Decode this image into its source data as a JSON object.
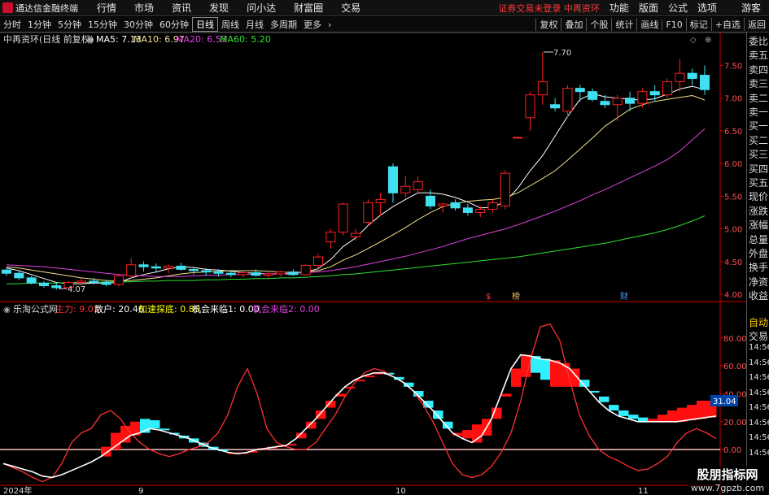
{
  "app": {
    "title": "通达信金融终端"
  },
  "menu": [
    "行情",
    "市场",
    "资讯",
    "发现",
    "问小达",
    "财富圈",
    "交易"
  ],
  "login_status": "证券交易未登录  中再资环",
  "top_right": [
    "功能",
    "版面",
    "公式",
    "选项"
  ],
  "guest": "游客",
  "periods": [
    "分时",
    "1分钟",
    "5分钟",
    "15分钟",
    "30分钟",
    "60分钟",
    "日线",
    "周线",
    "月线",
    "多周期",
    "更多"
  ],
  "active_period": "日线",
  "toolbar_right": [
    "复权",
    "叠加",
    "个股",
    "统计",
    "画线",
    "F10",
    "标记",
    "+自选",
    "返回"
  ],
  "stock": {
    "title": "中再资环(日线 前复权)"
  },
  "ma": [
    {
      "label": "MA5: 7.13",
      "color": "#ffffff"
    },
    {
      "label": "MA10: 6.97",
      "color": "#f2e28a"
    },
    {
      "label": "MA20: 6.53",
      "color": "#e040e0"
    },
    {
      "label": "MA60: 5.20",
      "color": "#30e030"
    }
  ],
  "price_annotations": {
    "high": "7.70",
    "low": "4.07"
  },
  "event_marks": [
    {
      "label": "$",
      "color": "#ff4040"
    },
    {
      "label": "榜",
      "color": "#f0c060"
    },
    {
      "label": "财",
      "color": "#4aa0ff"
    }
  ],
  "indicator": {
    "name": "乐淘公式网",
    "values": [
      {
        "label": "主力: 9.03",
        "color": "#ff3030"
      },
      {
        "label": "散户: 20.46",
        "color": "#ffffff"
      },
      {
        "label": "加速探底: 0.85",
        "color": "#ffff00"
      },
      {
        "label": "机会来临1: 0.00",
        "color": "#ffffff"
      },
      {
        "label": "机会来临2: 0.00",
        "color": "#e040e0"
      }
    ],
    "current_value": "31.04"
  },
  "date_labels": [
    "2024年",
    "9",
    "10",
    "11"
  ],
  "right_panel": [
    "委比",
    "卖五",
    "卖四",
    "卖三",
    "卖二",
    "卖一",
    "买一",
    "买二",
    "买三",
    "买四",
    "买五",
    "现价",
    "涨跌",
    "涨幅",
    "总量",
    "外盘",
    "换手",
    "净资",
    "收益",
    "自动",
    "交易"
  ],
  "right_panel_times": [
    "14:56",
    "14:56",
    "14:56",
    "14:56",
    "14:56",
    "14:56",
    "14:56",
    "14:56"
  ],
  "watermark": {
    "line1": "股朋指标网",
    "line2": "www.7gpzb.com"
  },
  "chart_data": [
    {
      "type": "candlestick",
      "title": "中再资环(日线 前复权)",
      "y_ticks": [
        4.0,
        4.5,
        5.0,
        5.5,
        6.0,
        6.5,
        7.0,
        7.5
      ],
      "ylim": [
        3.9,
        7.78
      ],
      "grid": false,
      "up_color": "#ff2020",
      "down_color": "#40e0f0",
      "candles": [
        [
          4.37,
          4.4,
          4.28,
          4.32
        ],
        [
          4.32,
          4.36,
          4.22,
          4.25
        ],
        [
          4.25,
          4.28,
          4.15,
          4.17
        ],
        [
          4.17,
          4.2,
          4.1,
          4.13
        ],
        [
          4.13,
          4.18,
          4.07,
          4.1
        ],
        [
          4.1,
          4.2,
          4.08,
          4.18
        ],
        [
          4.18,
          4.24,
          4.14,
          4.2
        ],
        [
          4.2,
          4.25,
          4.15,
          4.18
        ],
        [
          4.18,
          4.22,
          4.12,
          4.15
        ],
        [
          4.15,
          4.3,
          4.12,
          4.28
        ],
        [
          4.28,
          4.55,
          4.25,
          4.45
        ],
        [
          4.45,
          4.5,
          4.35,
          4.42
        ],
        [
          4.42,
          4.47,
          4.33,
          4.4
        ],
        [
          4.4,
          4.45,
          4.32,
          4.43
        ],
        [
          4.43,
          4.48,
          4.36,
          4.38
        ],
        [
          4.38,
          4.42,
          4.3,
          4.36
        ],
        [
          4.36,
          4.4,
          4.28,
          4.34
        ],
        [
          4.34,
          4.38,
          4.27,
          4.32
        ],
        [
          4.32,
          4.36,
          4.26,
          4.3
        ],
        [
          4.3,
          4.35,
          4.26,
          4.33
        ],
        [
          4.33,
          4.38,
          4.27,
          4.29
        ],
        [
          4.29,
          4.34,
          4.24,
          4.31
        ],
        [
          4.31,
          4.36,
          4.27,
          4.34
        ],
        [
          4.34,
          4.38,
          4.28,
          4.3
        ],
        [
          4.3,
          4.46,
          4.29,
          4.44
        ],
        [
          4.44,
          4.62,
          4.4,
          4.57
        ],
        [
          4.8,
          5.0,
          4.7,
          4.95
        ],
        [
          4.95,
          5.4,
          4.9,
          5.38
        ],
        [
          4.88,
          5.0,
          4.82,
          4.93
        ],
        [
          5.1,
          5.45,
          5.05,
          5.4
        ],
        [
          5.4,
          5.55,
          5.2,
          5.45
        ],
        [
          5.95,
          6.0,
          5.4,
          5.55
        ],
        [
          5.55,
          5.8,
          5.48,
          5.65
        ],
        [
          5.6,
          5.8,
          5.55,
          5.72
        ],
        [
          5.5,
          5.6,
          5.3,
          5.35
        ],
        [
          5.35,
          5.4,
          5.25,
          5.38
        ],
        [
          5.4,
          5.45,
          5.28,
          5.32
        ],
        [
          5.32,
          5.38,
          5.2,
          5.25
        ],
        [
          5.25,
          5.35,
          5.18,
          5.3
        ],
        [
          5.3,
          5.45,
          5.25,
          5.4
        ],
        [
          5.35,
          5.9,
          5.3,
          5.85
        ],
        [
          6.4,
          6.4,
          6.4,
          6.4
        ],
        [
          6.7,
          7.1,
          6.5,
          7.05
        ],
        [
          7.05,
          7.7,
          6.9,
          7.25
        ],
        [
          6.9,
          7.0,
          6.8,
          6.85
        ],
        [
          6.8,
          7.2,
          6.7,
          7.15
        ],
        [
          7.15,
          7.2,
          6.95,
          7.1
        ],
        [
          7.1,
          7.15,
          6.95,
          6.98
        ],
        [
          6.95,
          7.05,
          6.85,
          6.9
        ],
        [
          6.9,
          7.05,
          6.65,
          7.0
        ],
        [
          7.0,
          7.1,
          6.8,
          6.92
        ],
        [
          6.92,
          7.15,
          6.85,
          7.1
        ],
        [
          7.1,
          7.2,
          6.95,
          7.05
        ],
        [
          7.05,
          7.3,
          7.0,
          7.25
        ],
        [
          7.25,
          7.6,
          7.1,
          7.38
        ],
        [
          7.38,
          7.45,
          7.2,
          7.3
        ],
        [
          7.35,
          7.5,
          7.05,
          7.13
        ]
      ],
      "ma_series": [
        {
          "name": "MA5",
          "color": "#ffffff",
          "values": [
            4.4,
            4.36,
            4.3,
            4.24,
            4.18,
            4.16,
            4.16,
            4.17,
            4.17,
            4.18,
            4.25,
            4.3,
            4.34,
            4.39,
            4.42,
            4.41,
            4.38,
            4.37,
            4.35,
            4.33,
            4.32,
            4.31,
            4.31,
            4.31,
            4.34,
            4.39,
            4.53,
            4.73,
            4.86,
            5.05,
            5.21,
            5.34,
            5.45,
            5.55,
            5.55,
            5.53,
            5.48,
            5.41,
            5.32,
            5.33,
            5.42,
            5.62,
            5.89,
            6.12,
            6.42,
            6.72,
            6.98,
            7.07,
            7.02,
            7.0,
            6.98,
            6.97,
            6.99,
            7.06,
            7.14,
            7.18,
            7.13
          ]
        },
        {
          "name": "MA10",
          "color": "#f2e28a",
          "values": [
            4.42,
            4.4,
            4.37,
            4.34,
            4.31,
            4.28,
            4.25,
            4.23,
            4.21,
            4.2,
            4.21,
            4.23,
            4.25,
            4.28,
            4.31,
            4.33,
            4.34,
            4.35,
            4.36,
            4.36,
            4.36,
            4.35,
            4.34,
            4.33,
            4.34,
            4.36,
            4.42,
            4.52,
            4.6,
            4.7,
            4.8,
            4.91,
            5.02,
            5.14,
            5.25,
            5.34,
            5.39,
            5.42,
            5.44,
            5.45,
            5.48,
            5.55,
            5.66,
            5.77,
            5.89,
            6.05,
            6.22,
            6.39,
            6.57,
            6.7,
            6.83,
            6.9,
            6.95,
            6.98,
            7.01,
            7.04,
            6.97
          ]
        },
        {
          "name": "MA20",
          "color": "#e040e0",
          "values": [
            4.45,
            4.44,
            4.43,
            4.42,
            4.4,
            4.38,
            4.36,
            4.34,
            4.32,
            4.3,
            4.29,
            4.28,
            4.27,
            4.27,
            4.27,
            4.28,
            4.29,
            4.29,
            4.3,
            4.3,
            4.31,
            4.31,
            4.32,
            4.32,
            4.33,
            4.34,
            4.36,
            4.39,
            4.42,
            4.46,
            4.5,
            4.54,
            4.58,
            4.63,
            4.68,
            4.73,
            4.79,
            4.85,
            4.9,
            4.95,
            5.0,
            5.06,
            5.13,
            5.2,
            5.27,
            5.35,
            5.43,
            5.52,
            5.6,
            5.69,
            5.78,
            5.87,
            5.96,
            6.06,
            6.19,
            6.36,
            6.53
          ]
        },
        {
          "name": "MA60",
          "color": "#30e030",
          "values": [
            4.16,
            4.16,
            4.17,
            4.17,
            4.17,
            4.18,
            4.18,
            4.18,
            4.19,
            4.19,
            4.19,
            4.2,
            4.2,
            4.21,
            4.21,
            4.21,
            4.22,
            4.22,
            4.23,
            4.23,
            4.24,
            4.24,
            4.25,
            4.25,
            4.26,
            4.27,
            4.28,
            4.3,
            4.31,
            4.33,
            4.35,
            4.37,
            4.39,
            4.41,
            4.43,
            4.45,
            4.47,
            4.49,
            4.51,
            4.53,
            4.55,
            4.57,
            4.6,
            4.63,
            4.66,
            4.69,
            4.72,
            4.75,
            4.78,
            4.82,
            4.86,
            4.9,
            4.94,
            4.99,
            5.05,
            5.12,
            5.2
          ]
        }
      ]
    },
    {
      "type": "line",
      "title": "乐淘公式网",
      "y_ticks": [
        0.0,
        20.0,
        40.0,
        60.0,
        80.0
      ],
      "ylim": [
        -25,
        95
      ],
      "grid": false,
      "series": [
        {
          "name": "主力",
          "color": "#ff3030",
          "values": [
            -10,
            -13,
            -16,
            -20,
            -23,
            -20,
            -10,
            5,
            12,
            15,
            25,
            28,
            22,
            12,
            5,
            0,
            -3,
            -5,
            -3,
            0,
            2,
            5,
            12,
            25,
            45,
            58,
            40,
            15,
            5,
            2,
            0,
            0,
            5,
            15,
            25,
            38,
            48,
            55,
            58,
            56,
            52,
            48,
            42,
            32,
            20,
            5,
            -10,
            -18,
            -20,
            -18,
            -12,
            -2,
            12,
            35,
            65,
            88,
            90,
            78,
            50,
            25,
            10,
            0,
            -5,
            -8,
            -12,
            -15,
            -14,
            -10,
            -5,
            5,
            12,
            15,
            12,
            8
          ]
        },
        {
          "name": "散户",
          "color": "#ffffff",
          "values": [
            -10,
            -12,
            -14,
            -16,
            -19,
            -20,
            -18,
            -15,
            -12,
            -9,
            -5,
            0,
            5,
            10,
            12,
            15,
            14,
            12,
            10,
            8,
            5,
            2,
            0,
            -2,
            -3,
            -2,
            0,
            1,
            2,
            3,
            8,
            15,
            22,
            30,
            38,
            45,
            50,
            53,
            55,
            55,
            52,
            48,
            42,
            35,
            28,
            20,
            12,
            8,
            5,
            10,
            22,
            40,
            58,
            68,
            67,
            65,
            64,
            62,
            58,
            50,
            42,
            34,
            28,
            24,
            22,
            20,
            20,
            20,
            20,
            20,
            21,
            22,
            23,
            24
          ]
        },
        {
          "name": "填充上沿",
          "color": "#ff2020",
          "values": [
            null,
            null,
            null,
            null,
            null,
            null,
            null,
            null,
            null,
            null,
            2,
            12,
            17,
            20,
            22,
            21,
            15,
            12,
            8,
            5,
            2,
            0,
            -1,
            -2,
            -2,
            -1,
            1,
            2,
            3,
            4,
            12,
            20,
            28,
            35,
            40,
            45,
            50,
            52,
            55,
            55,
            50,
            45,
            38,
            30,
            22,
            15,
            10,
            14,
            18,
            22,
            30,
            38,
            45,
            52,
            55,
            50,
            45,
            45,
            45,
            45,
            42,
            38,
            32,
            28,
            25,
            23,
            22,
            25,
            28,
            30,
            32,
            35,
            35,
            35
          ]
        }
      ]
    }
  ]
}
